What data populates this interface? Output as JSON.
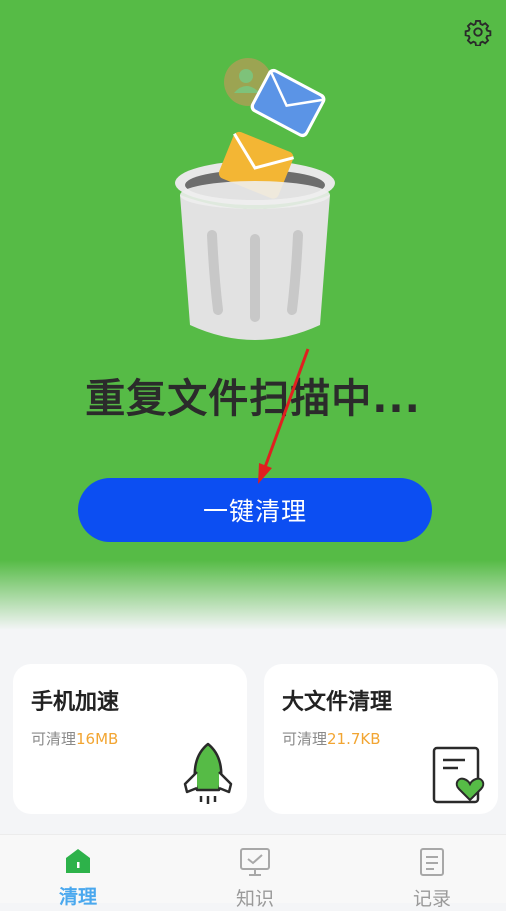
{
  "header": {
    "status_text": "重复文件扫描中..."
  },
  "main": {
    "clean_button_label": "一键清理"
  },
  "cards": [
    {
      "title": "手机加速",
      "sub_label": "可清理",
      "sub_value": "16MB"
    },
    {
      "title": "大文件清理",
      "sub_label": "可清理",
      "sub_value": "21.7KB"
    }
  ],
  "tabs": [
    {
      "label": "清理",
      "active": true
    },
    {
      "label": "知识",
      "active": false
    },
    {
      "label": "记录",
      "active": false
    }
  ],
  "colors": {
    "hero_green": "#56bb46",
    "button_blue": "#0c4ef2",
    "accent_orange": "#f2a532",
    "tab_active": "#4aa8ee",
    "annotation_red": "#e02020"
  },
  "icons": {
    "settings": "gear-icon",
    "card_1": "rocket-icon",
    "card_2": "document-heart-icon",
    "tab_1": "home-icon",
    "tab_2": "monitor-icon",
    "tab_3": "document-icon"
  }
}
